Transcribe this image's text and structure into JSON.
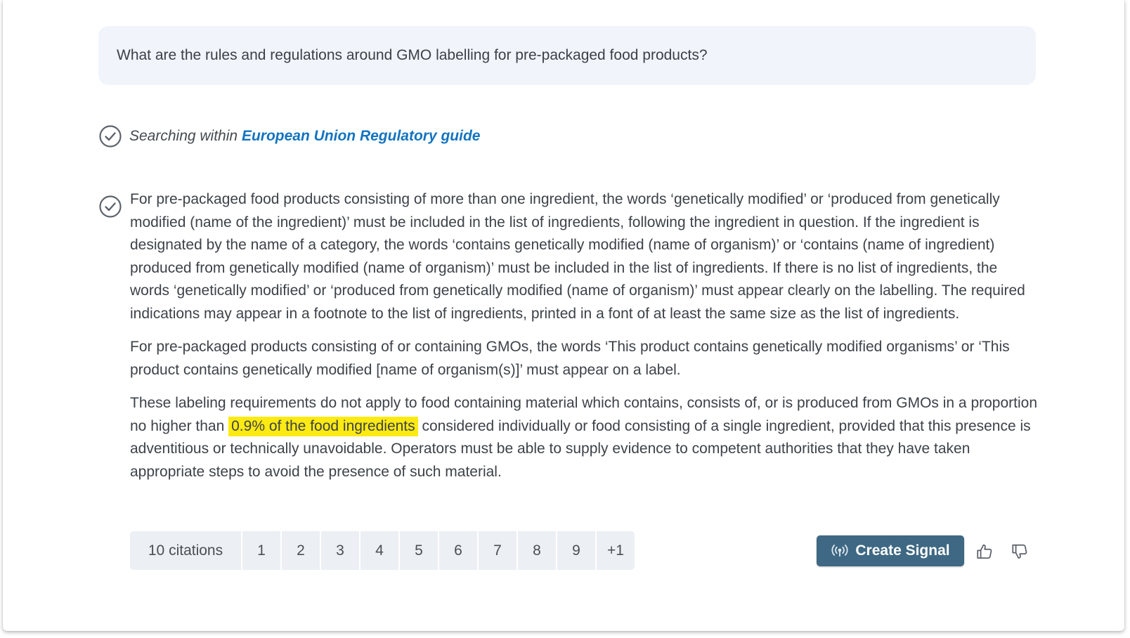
{
  "question": {
    "text": "What are the rules and regulations around GMO labelling for pre-packaged food products?"
  },
  "search_status": {
    "prefix": "Searching within",
    "source": "European Union Regulatory guide",
    "icon": "check-circle-icon"
  },
  "answer": {
    "icon": "check-circle-icon",
    "paragraph_1": "For pre-packaged food products consisting of more than one ingredient, the words ‘genetically modified’ or ‘produced from genetically modified (name of the ingredient)’ must be included in the list of ingredients, following the ingredient in question. If the ingredient is designated by the name of a category, the words ‘contains genetically modified (name of organism)’ or ‘contains (name of ingredient) produced from genetically modified (name of organism)’ must be included in the list of ingredients. If there is no list of ingredients, the words ‘genetically modified’ or ‘produced from genetically modified (name of organism)’ must appear clearly on the labelling. The required indications may appear in a footnote to the list of ingredients, printed in a font of at least the same size as the list of ingredients.",
    "paragraph_2": "For pre-packaged products consisting of or containing GMOs, the words ‘This product contains genetically modified organisms’ or ‘This product contains genetically modified [name of organism(s)]’ must appear on a label.",
    "paragraph_3_before": "These labeling requirements do not apply to food containing material which contains, consists of, or is produced from GMOs in a proportion no higher than",
    "paragraph_3_highlight": "0.9% of the food ingredients",
    "paragraph_3_after": "considered individually or food consisting of a single ingredient, provided that this presence is adventitious or technically unavoidable. Operators must be able to supply evidence to competent authorities that they have taken appropriate steps to avoid the presence of such material.",
    "highlight_color": "#fdea12"
  },
  "citations": {
    "label": "10 citations",
    "items": [
      "1",
      "2",
      "3",
      "4",
      "5",
      "6",
      "7",
      "8",
      "9",
      "+1"
    ]
  },
  "actions": {
    "create_signal_label": "Create Signal",
    "create_signal_icon": "broadcast-icon",
    "thumbs_up_icon": "thumbs-up-icon",
    "thumbs_down_icon": "thumbs-down-icon",
    "button_color": "#3e6883"
  },
  "colors": {
    "link": "#1473c0",
    "question_bg": "#f1f5fb",
    "citation_bg": "#eceff3"
  }
}
